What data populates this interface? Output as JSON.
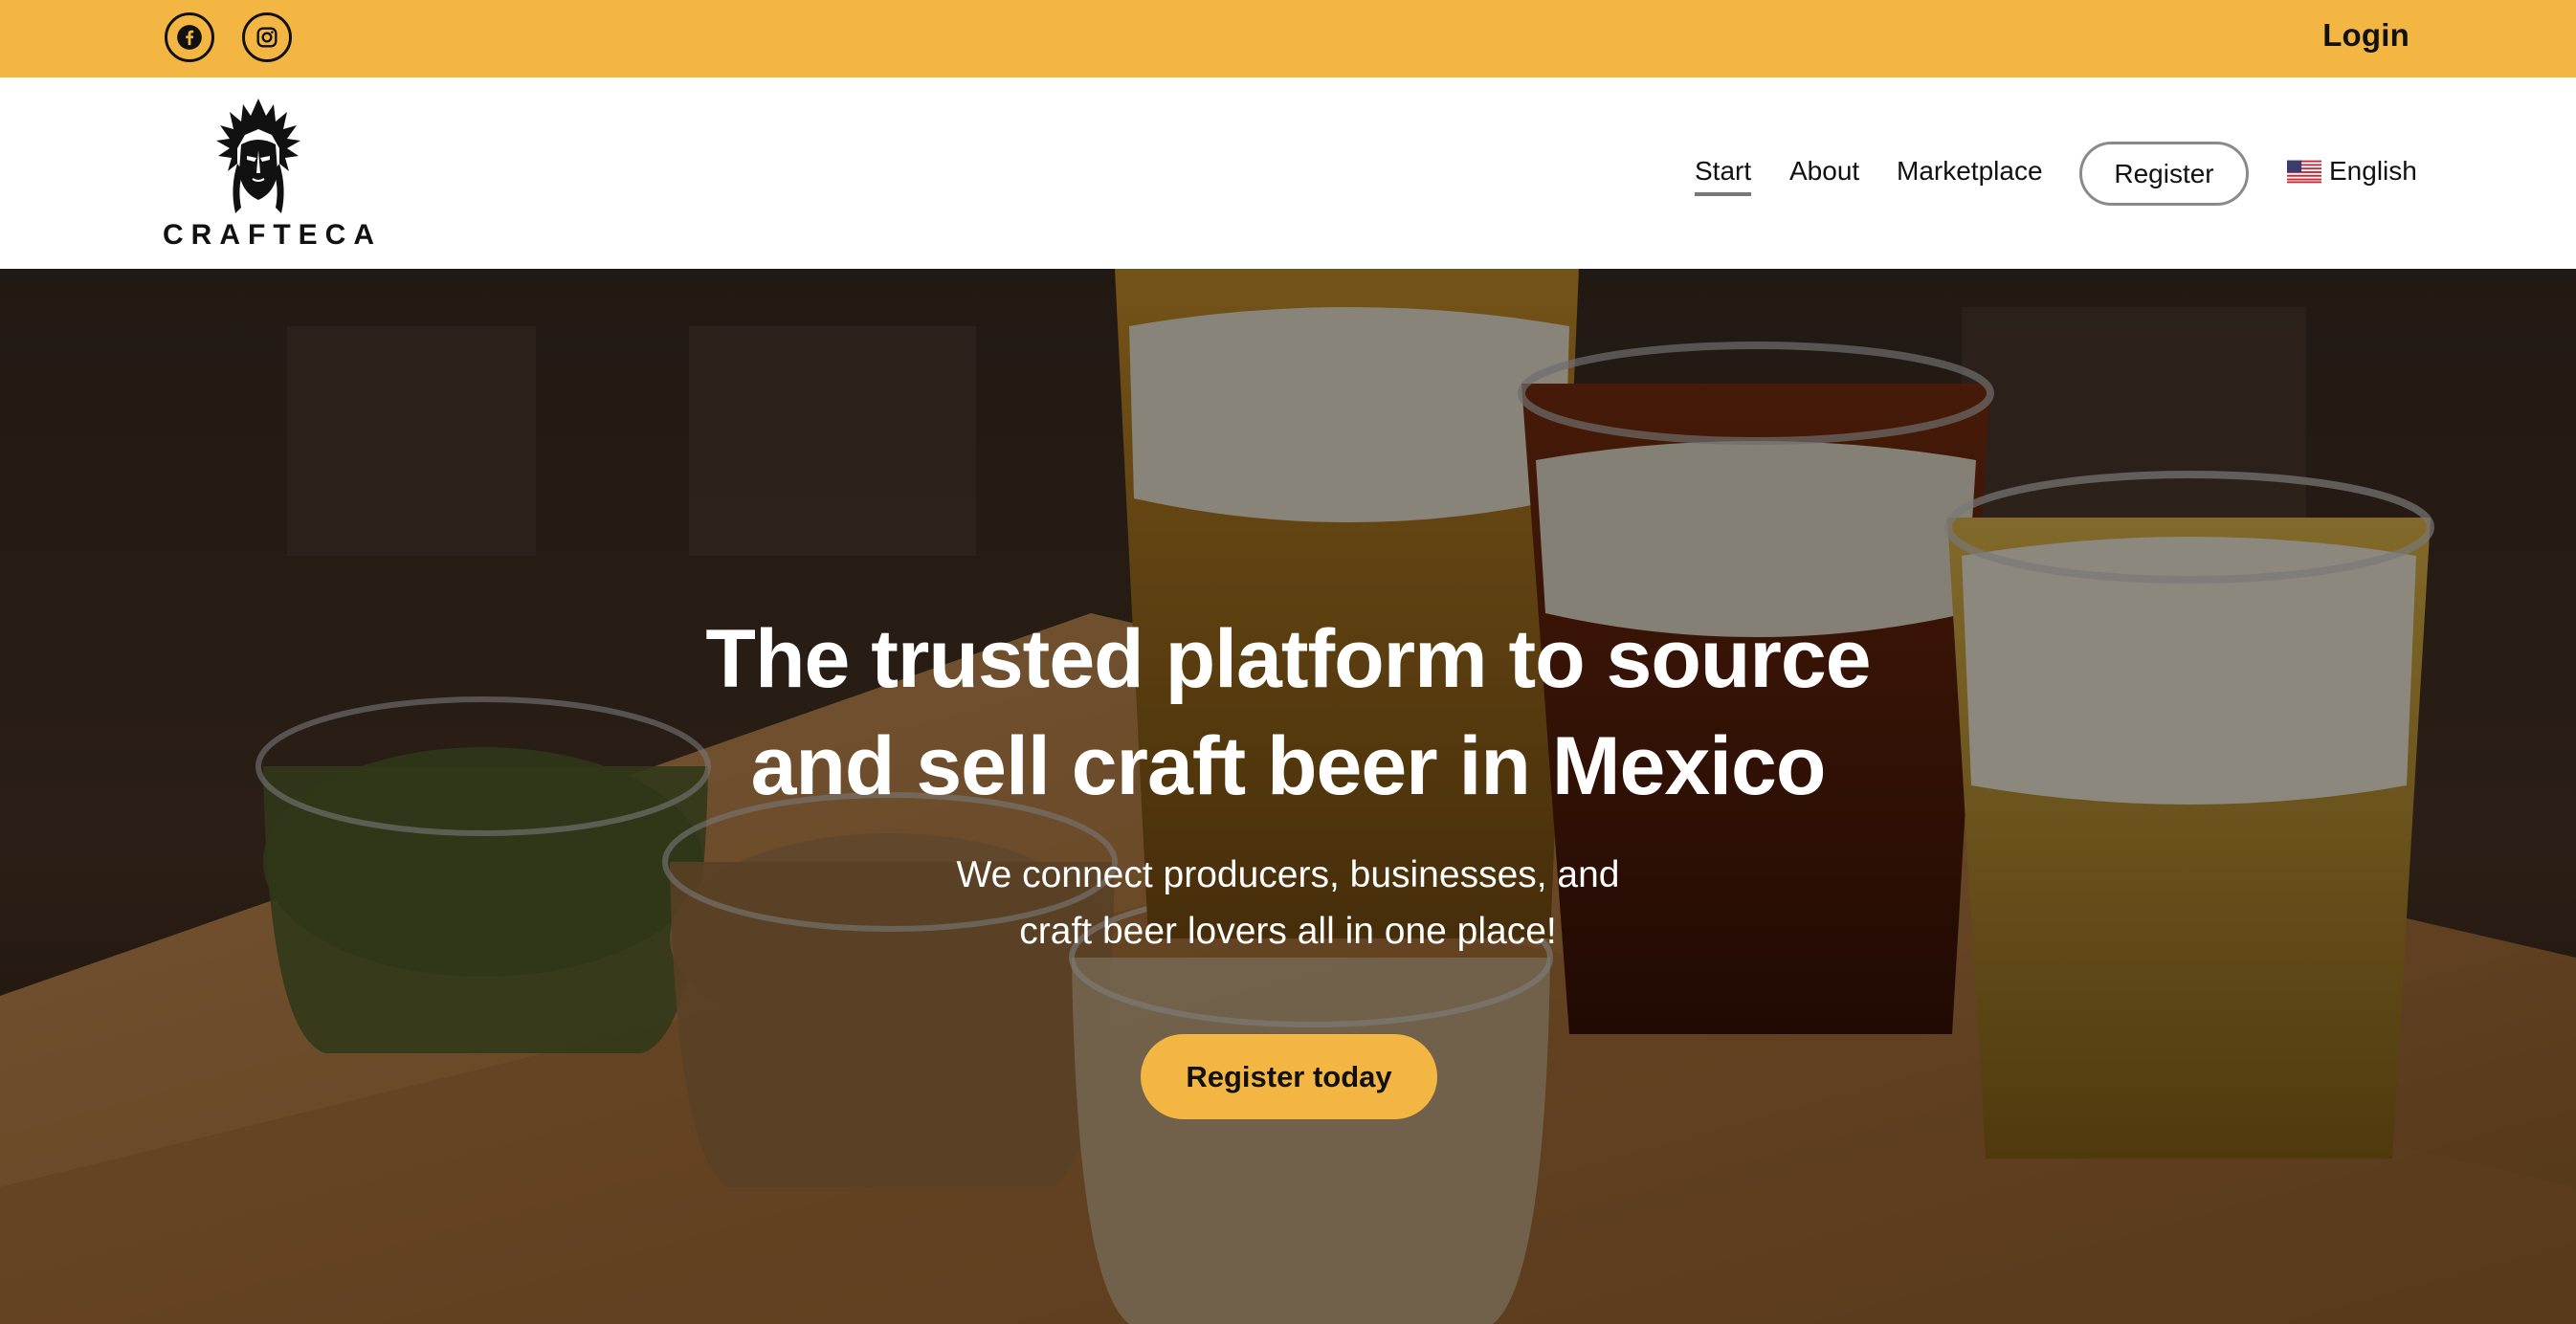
{
  "topbar": {
    "social": [
      {
        "name": "facebook",
        "icon": "facebook-icon"
      },
      {
        "name": "instagram",
        "icon": "instagram-icon"
      }
    ],
    "login_label": "Login",
    "background_color": "#f4b642"
  },
  "header": {
    "logo_text": "CRAFTECA",
    "nav": {
      "start": "Start",
      "about": "About",
      "marketplace": "Marketplace",
      "register": "Register",
      "language": "English",
      "language_flag": "us-flag-icon"
    },
    "active_item": "Start"
  },
  "hero": {
    "title_line1": "The trusted platform to source",
    "title_line2": "and sell craft beer in Mexico",
    "subtitle_line1": "We connect producers, businesses, and",
    "subtitle_line2": "craft beer lovers all in one place!",
    "cta_label": "Register today",
    "accent_color": "#f4b642"
  }
}
